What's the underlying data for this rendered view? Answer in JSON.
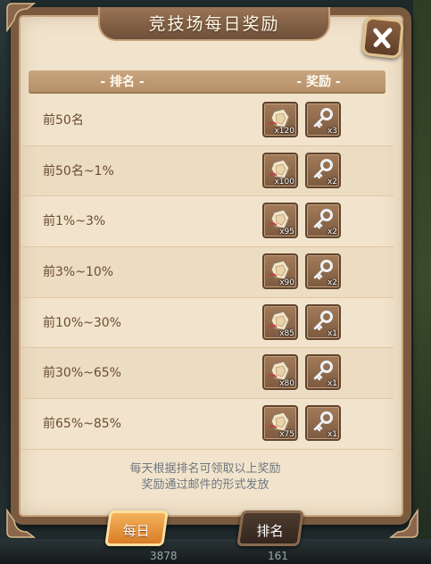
{
  "window": {
    "title": "竞技场每日奖励"
  },
  "table": {
    "header_rank": "- 排名 -",
    "header_reward": "- 奖励 -",
    "rows": [
      {
        "rank": "前50名",
        "shard_count": "x120",
        "key_count": "x3"
      },
      {
        "rank": "前50名~1%",
        "shard_count": "x100",
        "key_count": "x2"
      },
      {
        "rank": "前1%~3%",
        "shard_count": "x95",
        "key_count": "x2"
      },
      {
        "rank": "前3%~10%",
        "shard_count": "x90",
        "key_count": "x2"
      },
      {
        "rank": "前10%~30%",
        "shard_count": "x85",
        "key_count": "x1"
      },
      {
        "rank": "前30%~65%",
        "shard_count": "x80",
        "key_count": "x1"
      },
      {
        "rank": "前65%~85%",
        "shard_count": "x75",
        "key_count": "x1"
      }
    ]
  },
  "note": {
    "line1": "每天根据排名可领取以上奖励",
    "line2": "奖励通过邮件的形式发放"
  },
  "tabs": {
    "daily": "每日",
    "rank": "排名",
    "active": "daily"
  },
  "background": {
    "stat_left": "3878",
    "stat_right": "161"
  },
  "icons": {
    "close": "close-icon",
    "reward_1": "shard-icon",
    "reward_2": "key-icon"
  },
  "colors": {
    "parchment": "#f2e4cc",
    "frame": "#7a5a3f",
    "active_tab": "#e8953c",
    "rank_text": "#6b4c34"
  }
}
